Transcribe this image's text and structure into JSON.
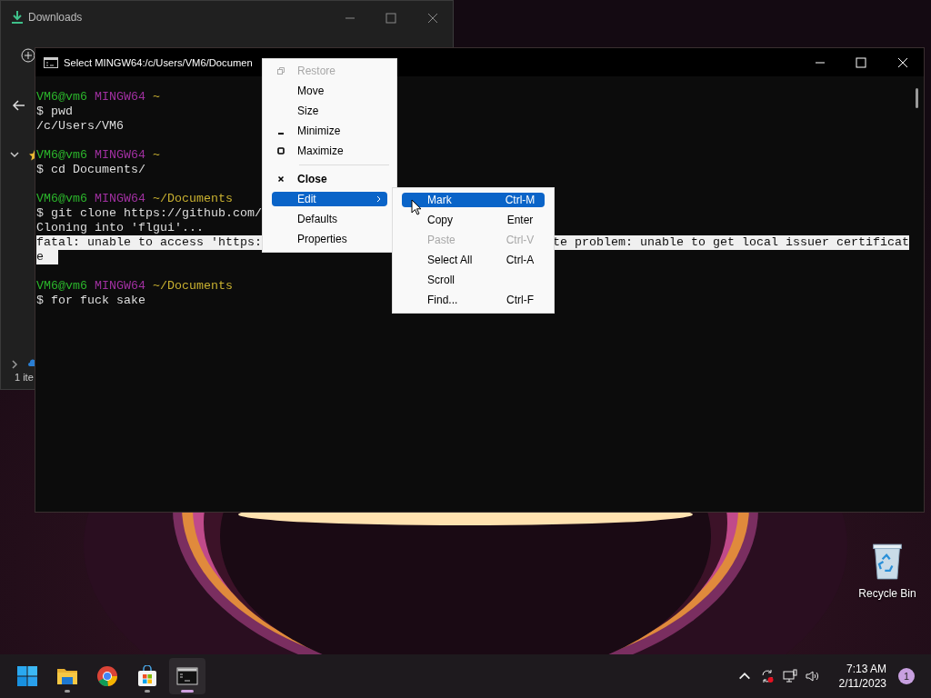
{
  "downloads_window": {
    "title": "Downloads",
    "status": "1 ite"
  },
  "terminal": {
    "title": "Select MINGW64:/c/Users/VM6/Documen",
    "lines": [
      {
        "kind": "prompt",
        "user": "VM6@vm6",
        "system": "MINGW64",
        "path": "~"
      },
      {
        "kind": "text",
        "segments": [
          "$ pwd"
        ],
        "selected": false
      },
      {
        "kind": "text",
        "segments": [
          "/c/Users/VM6"
        ],
        "selected": false
      },
      {
        "kind": "blank"
      },
      {
        "kind": "prompt",
        "user": "VM6@vm6",
        "system": "MINGW64",
        "path": "~"
      },
      {
        "kind": "text",
        "segments": [
          "$ cd Documents/"
        ],
        "selected": false
      },
      {
        "kind": "blank"
      },
      {
        "kind": "prompt",
        "user": "VM6@vm6",
        "system": "MINGW64",
        "path": "~/Documents"
      },
      {
        "kind": "text",
        "segments": [
          "$ git clone https://github.com/"
        ],
        "selected": false
      },
      {
        "kind": "text",
        "segments": [
          "Cloning into 'flgui'..."
        ],
        "selected": false
      },
      {
        "kind": "text",
        "segments": [
          "fatal: unable to access 'https:",
          "te problem: unable to get local issuer certificat"
        ],
        "selected": true
      },
      {
        "kind": "text",
        "segments": [
          "e"
        ],
        "selected": true
      },
      {
        "kind": "blank"
      },
      {
        "kind": "prompt",
        "user": "VM6@vm6",
        "system": "MINGW64",
        "path": "~/Documents"
      },
      {
        "kind": "text",
        "segments": [
          "$ for fuck sake"
        ],
        "selected": false
      }
    ]
  },
  "system_menu": [
    {
      "kind": "restore",
      "label": "Restore",
      "disabled": true,
      "selected": false,
      "default": false
    },
    {
      "kind": "plain",
      "label": "Move",
      "disabled": false,
      "selected": false,
      "default": false
    },
    {
      "kind": "plain",
      "label": "Size",
      "disabled": false,
      "selected": false,
      "default": false
    },
    {
      "kind": "minimize",
      "label": "Minimize",
      "disabled": false,
      "selected": false,
      "default": false
    },
    {
      "kind": "maximize",
      "label": "Maximize",
      "disabled": false,
      "selected": false,
      "default": false
    },
    {
      "kind": "separator"
    },
    {
      "kind": "close",
      "label": "Close",
      "disabled": false,
      "selected": false,
      "default": true
    },
    {
      "kind": "submenu",
      "label": "Edit",
      "disabled": false,
      "selected": true,
      "default": false
    },
    {
      "kind": "plain",
      "label": "Defaults",
      "disabled": false,
      "selected": false,
      "default": false
    },
    {
      "kind": "plain",
      "label": "Properties",
      "disabled": false,
      "selected": false,
      "default": false
    }
  ],
  "edit_submenu": [
    {
      "label": "Mark",
      "shortcut": "Ctrl-M",
      "disabled": false,
      "selected": true
    },
    {
      "label": "Copy",
      "shortcut": "Enter",
      "disabled": false,
      "selected": false
    },
    {
      "label": "Paste",
      "shortcut": "Ctrl-V",
      "disabled": true,
      "selected": false
    },
    {
      "label": "Select All",
      "shortcut": "Ctrl-A",
      "disabled": false,
      "selected": false
    },
    {
      "label": "Scroll",
      "disabled": false,
      "selected": false
    },
    {
      "label": "Find...",
      "shortcut": "Ctrl-F",
      "disabled": false,
      "selected": false
    }
  ],
  "desktop_icons": [
    {
      "kind": "recycle-bin",
      "label": "Recycle Bin"
    }
  ],
  "taskbar": {
    "apps": [
      {
        "kind": "start",
        "running": false,
        "selected": false
      },
      {
        "kind": "folder",
        "running": true,
        "selected": false
      },
      {
        "kind": "browser",
        "running": false,
        "selected": false
      },
      {
        "kind": "store",
        "running": true,
        "selected": false
      },
      {
        "kind": "terminal",
        "running": true,
        "selected": true
      }
    ]
  },
  "tray": {
    "time": "7:13 AM",
    "date": "2/11/2023",
    "notifications": "1"
  }
}
